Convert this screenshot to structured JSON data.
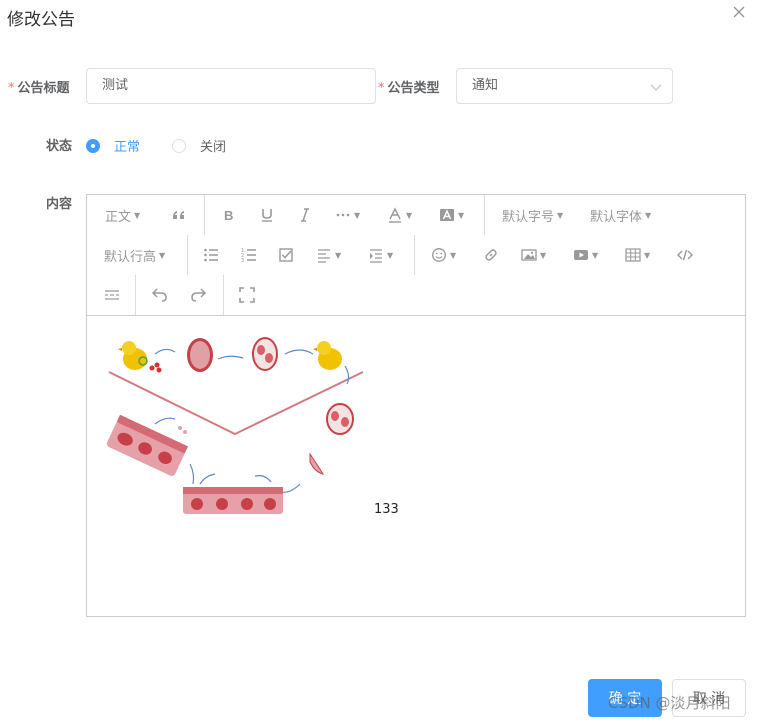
{
  "dialog": {
    "title": "修改公告"
  },
  "form": {
    "title_label": "公告标题",
    "title_value": "测试",
    "type_label": "公告类型",
    "type_value": "通知",
    "status_label": "状态",
    "status_options": [
      "正常",
      "关闭"
    ],
    "status_selected": "正常",
    "content_label": "内容"
  },
  "toolbar": {
    "paragraph": "正文",
    "font_size": "默认字号",
    "font_family": "默认字体",
    "line_height": "默认行高",
    "icons": [
      "quote-icon",
      "bold-icon",
      "underline-icon",
      "italic-icon",
      "more-icon",
      "font-color-icon",
      "bg-color-icon",
      "bullet-list-icon",
      "numbered-list-icon",
      "todo-icon",
      "align-icon",
      "indent-icon",
      "emotion-icon",
      "link-icon",
      "image-icon",
      "video-icon",
      "table-icon",
      "code-icon",
      "divider-icon",
      "undo-icon",
      "redo-icon",
      "fullscreen-icon"
    ]
  },
  "content": {
    "text": "133"
  },
  "buttons": {
    "confirm": "确 定",
    "cancel": "取 消"
  },
  "watermark": "CSDN @淡月斜阳",
  "colors": {
    "primary": "#409eff",
    "required": "#f56c6c",
    "border": "#dcdfe6"
  }
}
